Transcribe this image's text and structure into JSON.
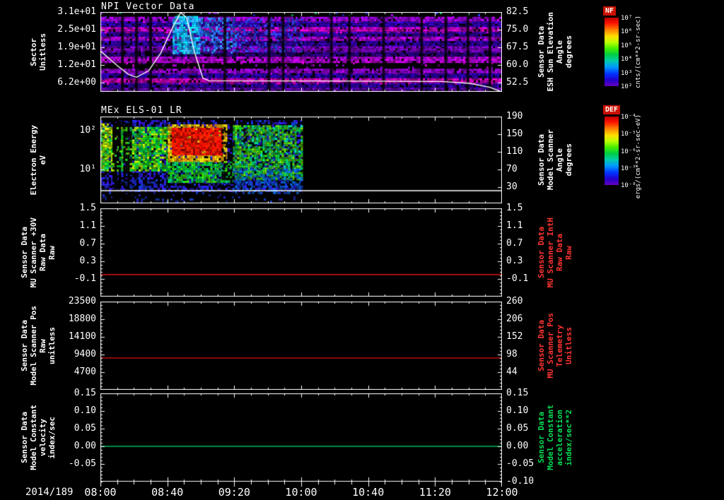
{
  "app": {
    "background": "#000000",
    "foreground": "#ffffff"
  },
  "x_axis": {
    "date_label": "2014/189",
    "tick_labels": [
      "08:00",
      "08:40",
      "09:20",
      "10:00",
      "10:40",
      "11:20",
      "12:00"
    ]
  },
  "chart_data": [
    {
      "id": "npi-vector",
      "type": "spectrogram",
      "title": "NPI Vector Data",
      "left_axis": {
        "label_lines": [
          "Sector",
          "Unitless"
        ],
        "tick_labels": [
          "3.1e+01",
          "2.5e+01",
          "1.9e+01",
          "1.2e+01",
          "6.2e+00"
        ],
        "tick_y": [
          0,
          25,
          50,
          75,
          100
        ],
        "color": "#ffffff"
      },
      "right_axis": {
        "label_lines": [
          "Sensor Data",
          "ESH Sun Elevation",
          "Angle",
          "degrees"
        ],
        "tick_labels": [
          "82.5",
          "75.0",
          "67.5",
          "60.0",
          "52.5"
        ],
        "tick_y": [
          0,
          25,
          50,
          75,
          100
        ],
        "color": "#ffffff"
      },
      "colorbar": {
        "name": "NF",
        "units": "cnts/(cm**2-sr-sec)",
        "tick_labels": [
          "10⁷",
          "10⁶",
          "10⁵",
          "10⁴",
          "10³",
          "10²"
        ]
      },
      "overlay_line": {
        "name": "ESH Sun Elevation Angle",
        "color": "#ffffff",
        "value_top": 82.5,
        "value_per_tick": 7.5,
        "points_t_value": [
          [
            0,
            66
          ],
          [
            0.04,
            60
          ],
          [
            0.07,
            56
          ],
          [
            0.09,
            54.8
          ],
          [
            0.12,
            57.5
          ],
          [
            0.15,
            65
          ],
          [
            0.18,
            76
          ],
          [
            0.2,
            82.3
          ],
          [
            0.215,
            80
          ],
          [
            0.235,
            65
          ],
          [
            0.255,
            54.5
          ],
          [
            0.27,
            53.3
          ],
          [
            0.55,
            53.2
          ],
          [
            0.85,
            53.0
          ],
          [
            0.92,
            52.2
          ],
          [
            0.97,
            50.5
          ],
          [
            1.0,
            48.5
          ]
        ]
      },
      "bands": [
        {
          "y0": 0.0,
          "y1": 0.06,
          "colors": [
            "#8800cc",
            "#00aa44",
            "#2233ff"
          ],
          "density": 0.06
        },
        {
          "y0": 0.06,
          "y1": 0.12,
          "colors": [
            "#9900dd",
            "#aa00ee"
          ],
          "density": 0.9
        },
        {
          "y0": 0.12,
          "y1": 0.19,
          "colors": [
            "#2a00a8",
            "#3300bb"
          ],
          "density": 0.85
        },
        {
          "y0": 0.19,
          "y1": 0.25,
          "colors": [
            "#cc00bb",
            "#bb00cc"
          ],
          "density": 0.9
        },
        {
          "y0": 0.25,
          "y1": 0.31,
          "colors": [
            "#3a00b8",
            "#2a0099"
          ],
          "density": 0.85
        },
        {
          "y0": 0.31,
          "y1": 0.36,
          "colors": [
            "#aa00cc",
            "#9900bb"
          ],
          "density": 0.88
        },
        {
          "y0": 0.36,
          "y1": 0.43,
          "colors": [
            "#2a0099",
            "#3300aa"
          ],
          "density": 0.82
        },
        {
          "y0": 0.43,
          "y1": 0.5,
          "colors": [
            "#8800cc",
            "#7700bb"
          ],
          "density": 0.88
        },
        {
          "y0": 0.5,
          "y1": 0.56,
          "colors": [
            "#220077",
            "#330088"
          ],
          "density": 0.75
        },
        {
          "y0": 0.56,
          "y1": 0.63,
          "colors": [
            "#aa00dd",
            "#bb00cc"
          ],
          "density": 0.9
        },
        {
          "y0": 0.63,
          "y1": 0.71,
          "colors": [
            "#7700bb",
            "#aa00aa"
          ],
          "density": 0.08
        },
        {
          "y0": 0.71,
          "y1": 0.77,
          "colors": [
            "#8800cc",
            "#9900cc"
          ],
          "density": 0.88
        },
        {
          "y0": 0.77,
          "y1": 0.83,
          "colors": [
            "#2a00a8",
            "#220099"
          ],
          "density": 0.82
        },
        {
          "y0": 0.83,
          "y1": 0.89,
          "colors": [
            "#bb00bb",
            "#cc00aa"
          ],
          "density": 0.88
        },
        {
          "y0": 0.89,
          "y1": 0.95,
          "colors": [
            "#2a0099",
            "#3300aa"
          ],
          "density": 0.8
        },
        {
          "y0": 0.95,
          "y1": 1.0,
          "colors": [
            "#6600aa",
            "#550099"
          ],
          "density": 0.8
        }
      ],
      "blobs": [
        {
          "t0": 0.18,
          "t1": 0.245,
          "e0": 0.05,
          "e1": 0.52,
          "colors": [
            "#00e0ff",
            "#33bbff",
            "#00aaff"
          ],
          "density": 0.88
        },
        {
          "t0": 0.245,
          "t1": 0.34,
          "e0": 0.07,
          "e1": 0.5,
          "colors": [
            "#2277ee",
            "#3388ff",
            "#2255dd"
          ],
          "density": 0.55
        },
        {
          "t0": 0.34,
          "t1": 0.5,
          "e0": 0.08,
          "e1": 0.48,
          "colors": [
            "#2233cc",
            "#3344dd"
          ],
          "density": 0.3
        }
      ],
      "vertical_gaps_t": [
        0.055,
        0.09,
        0.125,
        0.31,
        0.42,
        0.455,
        0.575,
        0.62,
        0.705,
        0.8,
        0.86,
        0.915,
        0.97
      ]
    },
    {
      "id": "els",
      "type": "spectrogram",
      "title": "MEx ELS-01 LR",
      "left_axis": {
        "label_lines": [
          "Electron Energy",
          "eV"
        ],
        "tick_labels": [
          "10²",
          "10¹"
        ],
        "tick_y": [
          20,
          75
        ],
        "color": "#ffffff"
      },
      "right_axis": {
        "label_lines": [
          "Sensor Data",
          "Model Scanner",
          "Angle",
          "degrees"
        ],
        "tick_labels": [
          "190",
          "150",
          "110",
          "70",
          "30"
        ],
        "tick_y": [
          0,
          25,
          50,
          75,
          100
        ],
        "color": "#ffffff"
      },
      "colorbar": {
        "name": "DEF",
        "units": "ergs/(cm**2-sr-sec-eV)",
        "tick_labels": [
          "10⁻⁴",
          "10⁻⁵",
          "10⁻⁶",
          "10⁻⁷",
          "10⁻⁸"
        ]
      },
      "overlay_line": {
        "name": "constant energy marker",
        "color": "#ffffff",
        "points_t_e": [
          [
            0,
            0.854
          ],
          [
            1,
            0.854
          ]
        ]
      },
      "regions": [
        {
          "t0": 0.0,
          "t1": 0.5,
          "e0": 0.04,
          "e1": 0.86,
          "colors": [
            "#2222cc",
            "#1133bb",
            "#3311cc"
          ],
          "density": 0.5
        },
        {
          "t0": 0.0,
          "t1": 0.5,
          "e0": 0.87,
          "e1": 0.98,
          "colors": [
            "#2222aa",
            "#113399"
          ],
          "density": 0.12
        },
        {
          "t0": 0.0,
          "t1": 0.17,
          "e0": 0.12,
          "e1": 0.62,
          "colors": [
            "#00cc22",
            "#44cc00",
            "#00bb55",
            "#aadd00"
          ],
          "density": 0.85
        },
        {
          "t0": 0.0,
          "t1": 0.04,
          "e0": 0.08,
          "e1": 0.5,
          "colors": [
            "#ccdd00",
            "#88cc00"
          ],
          "density": 0.5
        },
        {
          "t0": 0.03,
          "t1": 0.047,
          "e0": 0.0,
          "e1": 1.0,
          "colors": [
            "#000000"
          ],
          "density": 0.85
        },
        {
          "t0": 0.057,
          "t1": 0.075,
          "e0": 0.0,
          "e1": 1.0,
          "colors": [
            "#000000"
          ],
          "density": 0.7
        },
        {
          "t0": 0.168,
          "t1": 0.315,
          "e0": 0.09,
          "e1": 0.52,
          "colors": [
            "#ffee00",
            "#ffbb00",
            "#ff8800"
          ],
          "density": 0.88
        },
        {
          "t0": 0.178,
          "t1": 0.3,
          "e0": 0.13,
          "e1": 0.44,
          "colors": [
            "#ee1100",
            "#ff2200",
            "#cc0000"
          ],
          "density": 0.96
        },
        {
          "t0": 0.168,
          "t1": 0.33,
          "e0": 0.52,
          "e1": 0.75,
          "colors": [
            "#00cc33",
            "#33cc00",
            "#00aa66"
          ],
          "density": 0.8
        },
        {
          "t0": 0.302,
          "t1": 0.33,
          "e0": 0.0,
          "e1": 0.88,
          "colors": [
            "#000000"
          ],
          "density": 0.45
        },
        {
          "t0": 0.33,
          "t1": 0.5,
          "e0": 0.1,
          "e1": 0.72,
          "colors": [
            "#00bb44",
            "#33cc00",
            "#00cc88",
            "#66cc00"
          ],
          "density": 0.72
        },
        {
          "t0": 0.33,
          "t1": 0.5,
          "e0": 0.6,
          "e1": 0.88,
          "colors": [
            "#0066cc",
            "#1144cc"
          ],
          "density": 0.4
        }
      ]
    },
    {
      "id": "mu-scanner-30v",
      "type": "line",
      "title": "",
      "left_axis": {
        "label_lines": [
          "Sensor Data",
          "MU Scanner +30V",
          "Raw Data",
          "Raw"
        ],
        "tick_labels": [
          "1.5",
          "1.1",
          "0.7",
          "0.3",
          "-0.1"
        ],
        "tick_y": [
          0,
          25,
          50,
          75,
          100
        ],
        "color": "#ffffff"
      },
      "right_axis": {
        "label_lines": [
          "Sensor Data",
          "MU Scanner IntH",
          "Raw Data",
          "Raw"
        ],
        "tick_labels": [
          "1.5",
          "1.1",
          "0.7",
          "0.3",
          "-0.1"
        ],
        "tick_y": [
          0,
          25,
          50,
          75,
          100
        ],
        "color": "#ff3333"
      },
      "y_top": 1.5,
      "y_bottom": -0.5,
      "series": [
        {
          "name": "MU Scanner +30V Raw Data",
          "color": "#dd1111",
          "constant_value": 0.0
        }
      ]
    },
    {
      "id": "model-scanner-pos",
      "type": "line",
      "title": "",
      "left_axis": {
        "label_lines": [
          "Sensor Data",
          "Model Scanner Pos",
          "Raw",
          "unitless"
        ],
        "tick_labels": [
          "23500",
          "18800",
          "14100",
          "9400",
          "4700"
        ],
        "tick_y": [
          0,
          25,
          50,
          75,
          100
        ],
        "color": "#ffffff"
      },
      "right_axis": {
        "label_lines": [
          "Sensor Data",
          "MU Scanner Pos",
          "Telemetry",
          "Unitless"
        ],
        "tick_labels": [
          "260",
          "206",
          "152",
          "98",
          "44"
        ],
        "tick_y": [
          0,
          25,
          50,
          75,
          100
        ],
        "color": "#ff3333"
      },
      "y_top": 23500,
      "y_bottom": 0,
      "series": [
        {
          "name": "Model Scanner Pos Raw",
          "color": "#dd1111",
          "constant_value": 8500
        }
      ]
    },
    {
      "id": "model-constant-velocity",
      "type": "line",
      "title": "",
      "left_axis": {
        "label_lines": [
          "Sensor Data",
          "Model Constant",
          "velocity",
          "index/sec"
        ],
        "tick_labels": [
          "0.15",
          "0.10",
          "0.05",
          "0.00",
          "-0.05"
        ],
        "tick_y": [
          0,
          25,
          50,
          75,
          100
        ],
        "color": "#ffffff"
      },
      "right_axis": {
        "label_lines": [
          "Sensor Data",
          "Model Constant",
          "acceleration",
          "index/sec**2"
        ],
        "tick_labels": [
          "0.15",
          "0.10",
          "0.05",
          "0.00",
          "-0.05",
          "-0.10"
        ],
        "tick_y": [
          0,
          25,
          50,
          75,
          100,
          125
        ],
        "color": "#00dd55"
      },
      "y_top": 0.15,
      "y_bottom": -0.1,
      "series": [
        {
          "name": "Model Constant velocity",
          "color": "#00bb55",
          "constant_value": 0.0
        }
      ]
    }
  ]
}
